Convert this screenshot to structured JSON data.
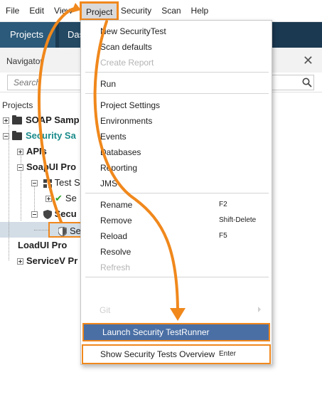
{
  "menubar": {
    "items": [
      "File",
      "Edit",
      "View",
      "Project",
      "Security",
      "Scan",
      "Help"
    ],
    "active": "Project"
  },
  "tabs": {
    "projects": "Projects",
    "dashboard": "Das"
  },
  "navigator": {
    "title": "Navigator",
    "close": "✕",
    "search_placeholder": "Search",
    "projects_label": "Projects"
  },
  "tree": {
    "soap_sample": "SOAP Samp",
    "security_sample": "Security Sa",
    "apis": "APIs",
    "soapui_pro": "SoapUI Pro",
    "test_suite": "Test S",
    "test_case": "Se",
    "security_tests": "Secu",
    "security_test": "Se",
    "loadui_pro": "LoadUI Pro",
    "servicev_pro": "ServiceV Pr"
  },
  "dropdown": {
    "new_security_test": "New SecurityTest",
    "scan_defaults": "Scan defaults",
    "create_report": "Create Report",
    "run": "Run",
    "project_settings": "Project Settings",
    "environments": "Environments",
    "events": "Events",
    "databases": "Databases",
    "reporting": "Reporting",
    "jms": "JMS",
    "rename": "Rename",
    "rename_shortcut": "F2",
    "remove": "Remove",
    "remove_shortcut": "Shift-Delete",
    "reload": "Reload",
    "reload_shortcut": "F5",
    "resolve": "Resolve",
    "refresh": "Refresh",
    "git": "Git",
    "launch_runner": "Launch Security TestRunner",
    "show_overview": "Show Security Tests Overview",
    "show_overview_shortcut": "Enter"
  },
  "colors": {
    "accent_orange": "#f0881c",
    "highlight_blue": "#4a6fa5",
    "tabbar": "#1b3a52",
    "teal_text": "#1a8a8a"
  }
}
